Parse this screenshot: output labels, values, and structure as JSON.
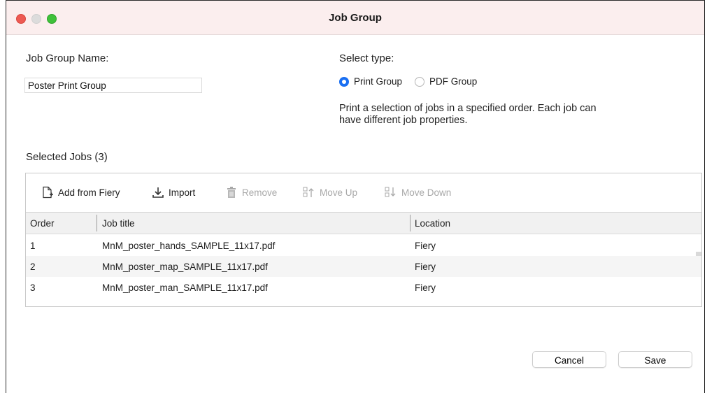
{
  "window": {
    "title": "Job Group"
  },
  "form": {
    "name_label": "Job Group Name:",
    "name_value": "Poster Print Group",
    "type_label": "Select type:",
    "types": [
      {
        "label": "Print Group",
        "selected": true
      },
      {
        "label": "PDF Group",
        "selected": false
      }
    ],
    "description_line1": "Print a selection of jobs in a specified order. Each job can",
    "description_line2": "have different job properties."
  },
  "jobs": {
    "heading": "Selected Jobs (3)",
    "toolbar": {
      "add": "Add from Fiery",
      "import": "Import",
      "remove": "Remove",
      "move_up": "Move Up",
      "move_down": "Move Down"
    },
    "columns": {
      "order": "Order",
      "title": "Job title",
      "location": "Location"
    },
    "rows": [
      {
        "order": "1",
        "title": "MnM_poster_hands_SAMPLE_11x17.pdf",
        "location": "Fiery"
      },
      {
        "order": "2",
        "title": "MnM_poster_map_SAMPLE_11x17.pdf",
        "location": "Fiery"
      },
      {
        "order": "3",
        "title": "MnM_poster_man_SAMPLE_11x17.pdf",
        "location": "Fiery"
      }
    ]
  },
  "buttons": {
    "cancel": "Cancel",
    "save": "Save"
  },
  "colors": {
    "accent": "#1a6ff2",
    "close": "#ed5a53",
    "maximize": "#3fc13a"
  },
  "icons": [
    "add-file-icon",
    "import-icon",
    "trash-icon",
    "move-up-icon",
    "move-down-icon"
  ]
}
